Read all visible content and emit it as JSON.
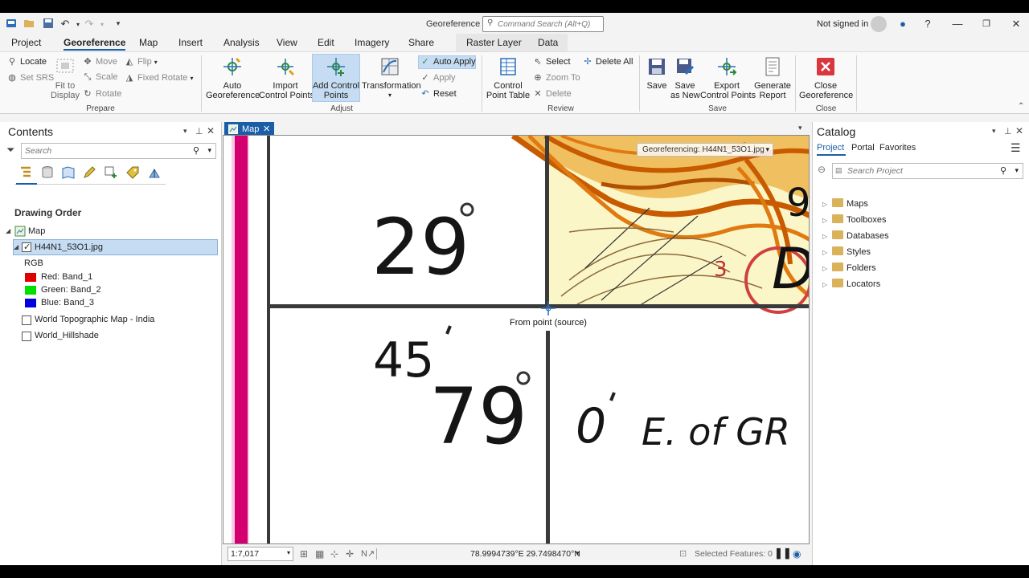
{
  "titlebar": {
    "title": "Georeference",
    "command_search_placeholder": "Command Search (Alt+Q)",
    "user": "Not signed in"
  },
  "tabs": [
    "Project",
    "Georeference",
    "Map",
    "Insert",
    "Analysis",
    "View",
    "Edit",
    "Imagery",
    "Share"
  ],
  "active_tab": "Georeference",
  "context_tabs": [
    "Raster Layer",
    "Data"
  ],
  "ribbon": {
    "prepare": {
      "label": "Prepare",
      "locate": "Locate",
      "set_srs": "Set SRS",
      "fit_to_display": "Fit to\nDisplay",
      "move": "Move",
      "scale": "Scale",
      "rotate": "Rotate",
      "flip": "Flip",
      "fixed_rotate": "Fixed Rotate"
    },
    "adjust": {
      "label": "Adjust",
      "auto_georeference": "Auto\nGeoreference",
      "import_control_points": "Import\nControl Points",
      "add_control_points": "Add Control\nPoints",
      "transformation": "Transformation",
      "auto_apply": "Auto Apply",
      "apply": "Apply",
      "reset": "Reset"
    },
    "review": {
      "label": "Review",
      "control_point_table": "Control\nPoint Table",
      "select": "Select",
      "zoom_to": "Zoom To",
      "delete": "Delete",
      "delete_all": "Delete All"
    },
    "save": {
      "label": "Save",
      "save": "Save",
      "save_as_new": "Save\nas New",
      "export_control_points": "Export\nControl Points",
      "generate_report": "Generate\nReport"
    },
    "close": {
      "label": "Close",
      "close_georeference": "Close\nGeoreference"
    }
  },
  "contents": {
    "title": "Contents",
    "search_placeholder": "Search",
    "drawing_order": "Drawing Order",
    "map_label": "Map",
    "layer_name": "H44N1_53O1.jpg",
    "rgb": "RGB",
    "bands": [
      {
        "label": "Red:  Band_1",
        "color": "#e00000"
      },
      {
        "label": "Green: Band_2",
        "color": "#00e000"
      },
      {
        "label": "Blue:  Band_3",
        "color": "#0000e0"
      }
    ],
    "other_layers": [
      "World Topographic Map - India",
      "World_Hillshade"
    ]
  },
  "map": {
    "tab_label": "Map",
    "georef_dropdown": "Georeferencing: H44N1_53O1.jpg",
    "tooltip": "From point (source)",
    "map_text": {
      "deg29": "29",
      "min45": "45",
      "deg79": "79",
      "zero": "0",
      "east": "E. of GR",
      "top_right_digits": "9",
      "top_right_d": "D",
      "contour_num": "3"
    },
    "scale": "1:7,017",
    "coordinates": "78.9994739°E 29.7498470°N",
    "selected_features": "Selected Features: 0"
  },
  "catalog": {
    "title": "Catalog",
    "tabs": [
      "Project",
      "Portal",
      "Favorites"
    ],
    "active_tab": "Project",
    "search_placeholder": "Search Project",
    "items": [
      "Maps",
      "Toolboxes",
      "Databases",
      "Styles",
      "Folders",
      "Locators"
    ]
  },
  "colors": {
    "accent": "#1a5ea8",
    "highlight": "#c5dcf2",
    "close_red": "#d9363e",
    "map_magenta": "#d4006f",
    "map_orange": "#e07a10",
    "map_yellow": "#fbf6c8"
  }
}
